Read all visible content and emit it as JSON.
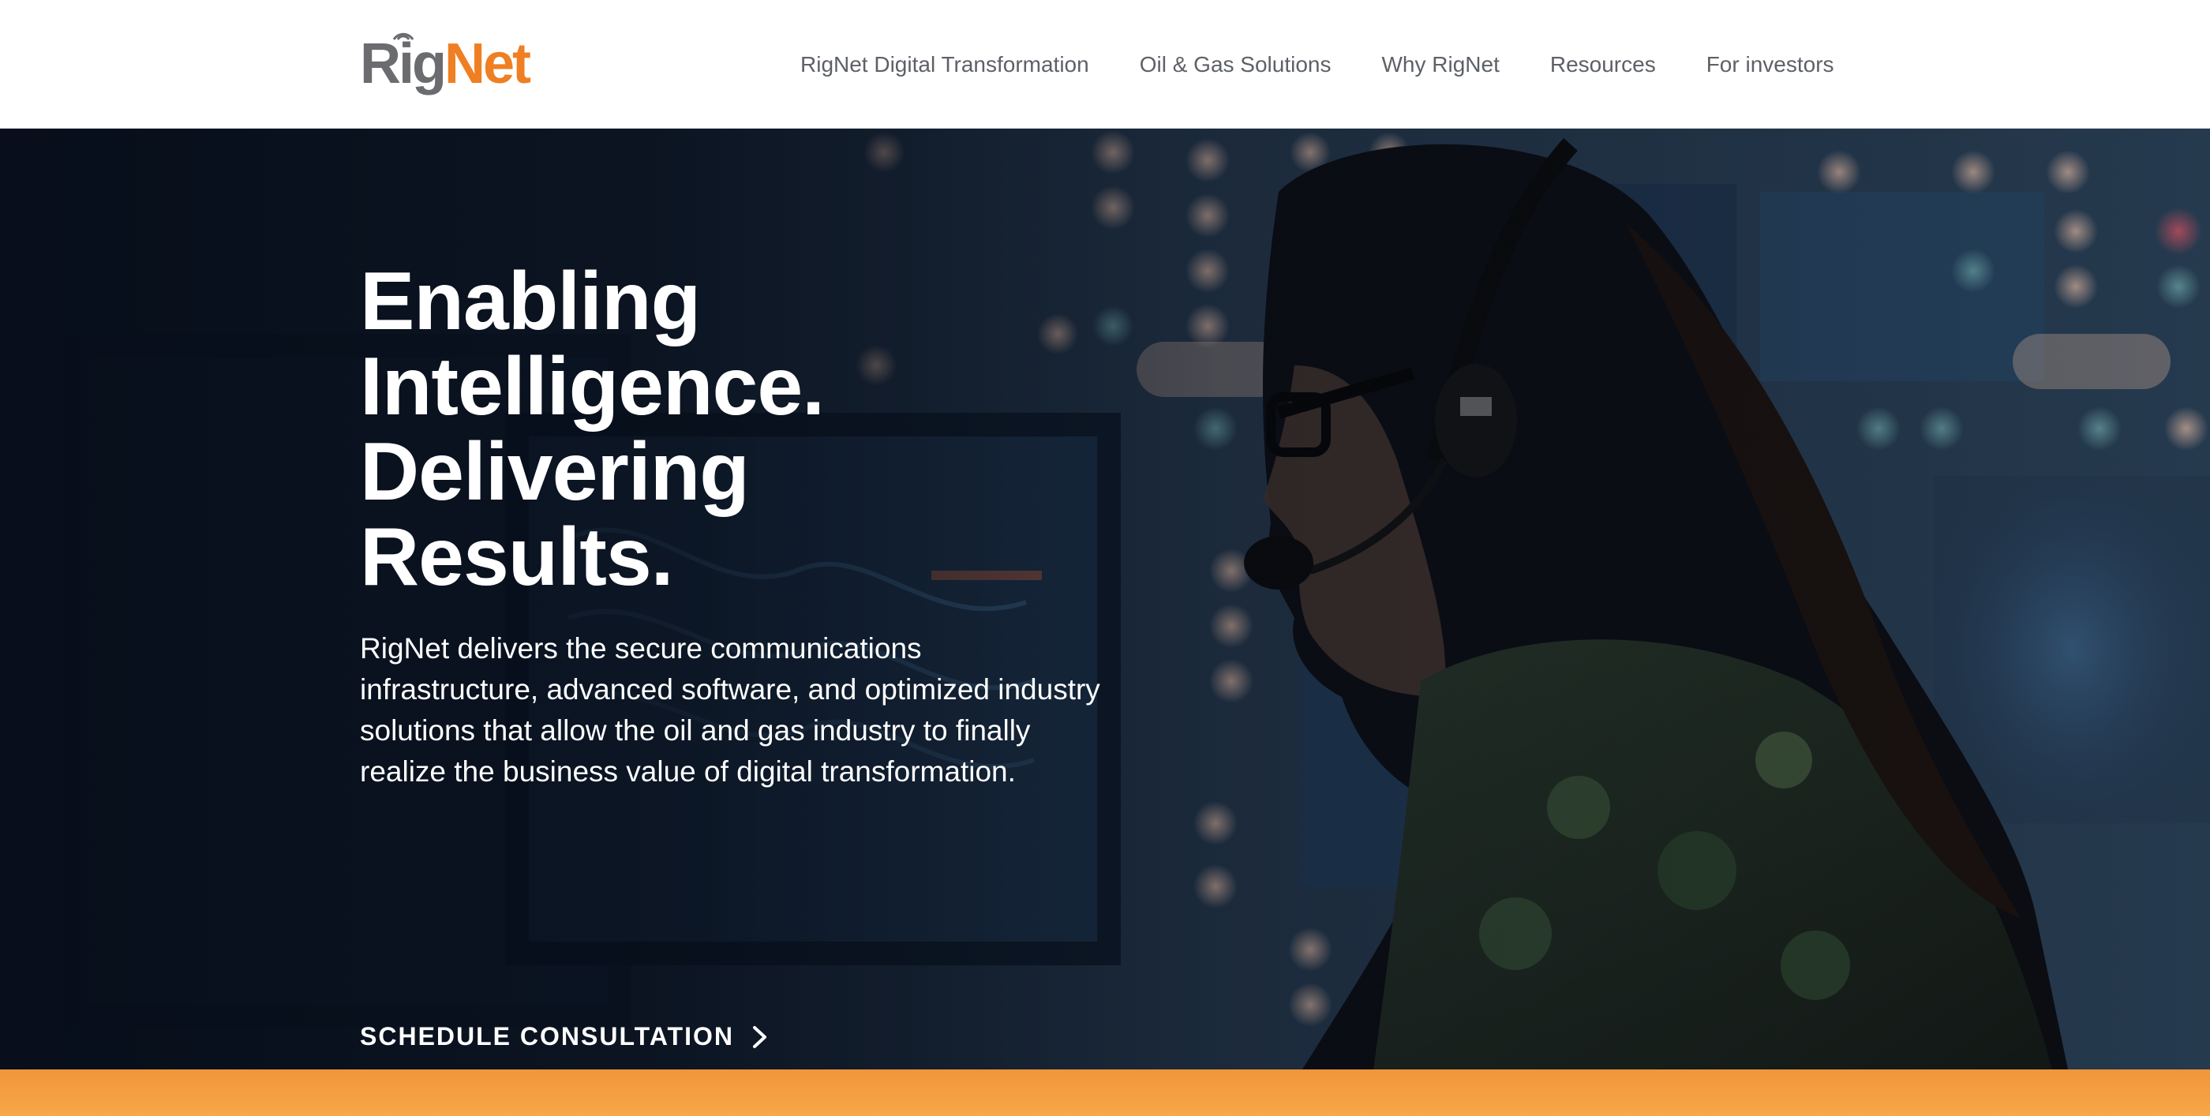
{
  "brand": {
    "logo_part1": "Rig",
    "logo_part2": "Net",
    "logo_color_primary": "#6b6c70",
    "logo_color_accent": "#ef7f22"
  },
  "nav": {
    "items": [
      {
        "label": "RigNet Digital Transformation"
      },
      {
        "label": "Oil & Gas Solutions"
      },
      {
        "label": "Why RigNet"
      },
      {
        "label": "Resources"
      },
      {
        "label": "For investors"
      }
    ]
  },
  "hero": {
    "headline_lines": [
      "Enabling",
      "Intelligence.",
      "Delivering",
      "Results."
    ],
    "body": "RigNet delivers the secure communications infrastructure, advanced software, and optimized industry solutions that allow the oil and gas industry to finally realize the business value of digital transformation.",
    "cta_label": "SCHEDULE CONSULTATION",
    "cta_icon": "chevron-right-icon",
    "background_image": "operator-with-headset-in-control-room"
  },
  "colors": {
    "accent_strip": "#f0953a",
    "header_background": "#ffffff",
    "nav_text": "#5d6167",
    "hero_text": "#ffffff"
  }
}
